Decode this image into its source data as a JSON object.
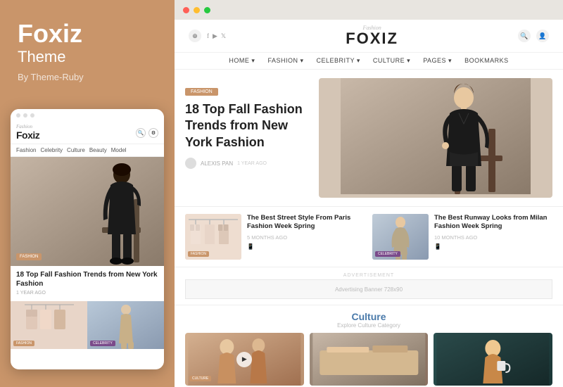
{
  "left": {
    "title": "Foxiz",
    "subtitle": "Theme",
    "by": "By Theme-Ruby"
  },
  "mobile": {
    "dots": [
      "dot1",
      "dot2",
      "dot3"
    ],
    "logo_script": "Fashion",
    "logo_main": "Foxiz",
    "categories": [
      "Fashion",
      "Celebrity",
      "Culture",
      "Beauty",
      "Model"
    ],
    "hero_badge": "FASHION",
    "hero_title": "18 Top Fall Fashion Trends from New York Fashion",
    "hero_meta": "1 YEAR AGO",
    "card1_badge": "FASHION",
    "card2_badge": "CELEBRITY"
  },
  "desktop": {
    "window_dots": [
      "red",
      "yellow",
      "green"
    ],
    "header": {
      "logo_script": "Fashion",
      "logo_main": "FOXIZ"
    },
    "nav": {
      "items": [
        "HOME ▾",
        "FASHION ▾",
        "CELEBRITY ▾",
        "CULTURE ▾",
        "PAGES ▾",
        "BOOKMARKS"
      ]
    },
    "hero": {
      "badge": "FASHION",
      "title": "18 Top Fall Fashion Trends from New York Fashion",
      "author": "ALEXIS PAN",
      "meta": "1 YEAR AGO"
    },
    "cards": [
      {
        "badge": "FASHION",
        "title": "The Best Street Style From Paris Fashion Week Spring",
        "meta": "5 MONTHS AGO"
      },
      {
        "badge": "CELEBRITY",
        "title": "The Best Runway Looks from Milan Fashion Week Spring",
        "meta": "10 MONTHS AGO"
      }
    ],
    "ad": {
      "label": "ADVERTISEMENT",
      "banner_text": "Advertising Banner 728x90"
    },
    "culture": {
      "title": "Culture",
      "subtitle": "Explore Culture Category",
      "cards": [
        {
          "badge": "CULTURE"
        },
        {
          "badge": ""
        },
        {
          "badge": ""
        }
      ]
    }
  }
}
